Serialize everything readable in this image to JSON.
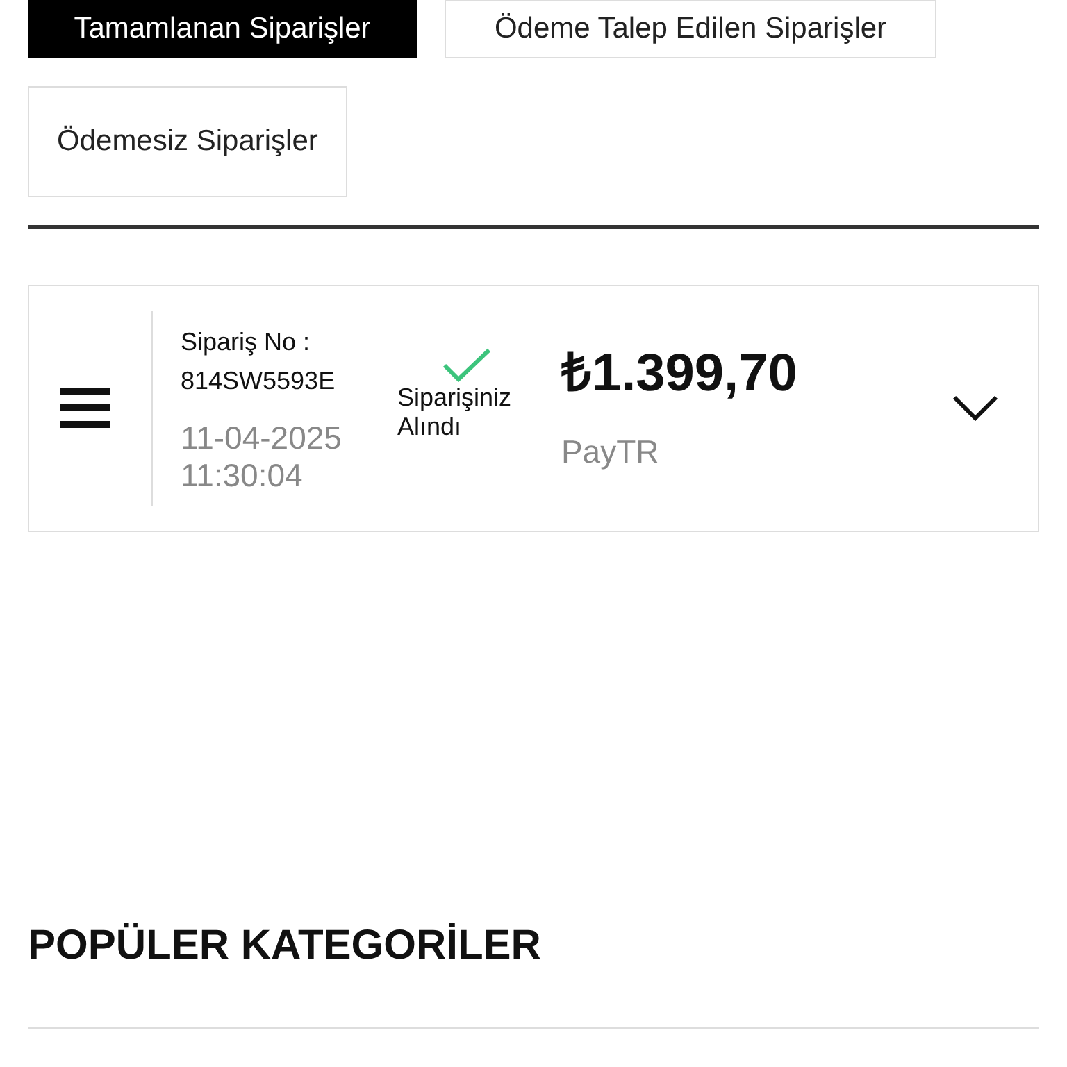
{
  "tabs": [
    {
      "label": "Tamamlanan Siparişler",
      "selected": true
    },
    {
      "label": "Ödeme Talep Edilen Siparişler",
      "selected": false
    },
    {
      "label": "Ödemesiz Siparişler",
      "selected": false
    }
  ],
  "order": {
    "number_label": "Sipariş No :",
    "number": "814SW5593E",
    "date": "11-04-2025",
    "time": "11:30:04",
    "status": "Siparişiniz Alındı",
    "price": "₺1.399,70",
    "payment_method": "PayTR"
  },
  "section_title": "POPÜLER KATEGORİLER"
}
